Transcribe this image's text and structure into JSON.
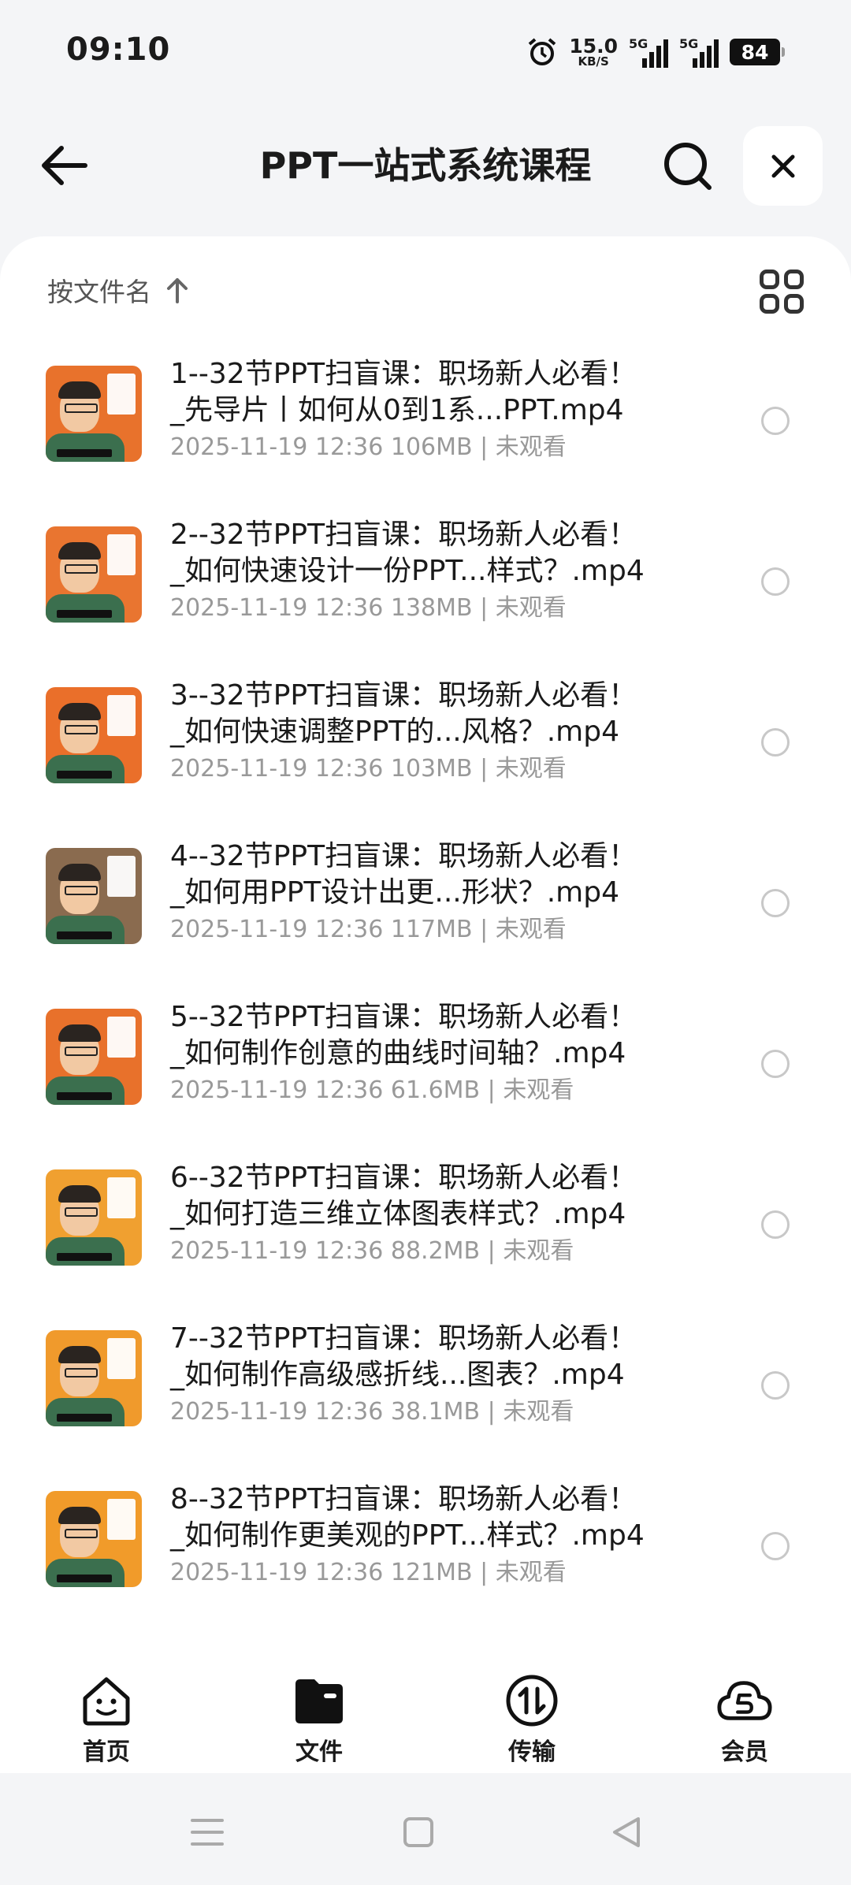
{
  "status": {
    "time": "09:10",
    "speed_value": "15.0",
    "speed_unit": "KB/S",
    "signal1": "5G",
    "signal2": "5G",
    "battery": "84"
  },
  "header": {
    "title": "PPT一站式系统课程"
  },
  "sort": {
    "label": "按文件名"
  },
  "files": [
    {
      "line1": "1--32节PPT扫盲课：职场新人必看！",
      "line2": "_先导片丨如何从0到1系...PPT.mp4",
      "meta": "2025-11-19 12:36  106MB | 未观看",
      "thumb_color": "#e8722c"
    },
    {
      "line1": "2--32节PPT扫盲课：职场新人必看！",
      "line2": "_如何快速设计一份PPT...样式？.mp4",
      "meta": "2025-11-19 12:36  138MB | 未观看",
      "thumb_color": "#e97530"
    },
    {
      "line1": "3--32节PPT扫盲课：职场新人必看！",
      "line2": "_如何快速调整PPT的...风格？.mp4",
      "meta": "2025-11-19 12:36  103MB | 未观看",
      "thumb_color": "#ea6f2a"
    },
    {
      "line1": "4--32节PPT扫盲课：职场新人必看！",
      "line2": "_如何用PPT设计出更...形状？.mp4",
      "meta": "2025-11-19 12:36  117MB | 未观看",
      "thumb_color": "#8a6b4f"
    },
    {
      "line1": "5--32节PPT扫盲课：职场新人必看！",
      "line2": "_如何制作创意的曲线时间轴？.mp4",
      "meta": "2025-11-19 12:36  61.6MB | 未观看",
      "thumb_color": "#e8712b"
    },
    {
      "line1": "6--32节PPT扫盲课：职场新人必看！",
      "line2": "_如何打造三维立体图表样式？.mp4",
      "meta": "2025-11-19 12:36  88.2MB | 未观看",
      "thumb_color": "#f0a030"
    },
    {
      "line1": "7--32节PPT扫盲课：职场新人必看！",
      "line2": "_如何制作高级感折线...图表？.mp4",
      "meta": "2025-11-19 12:36  38.1MB | 未观看",
      "thumb_color": "#f09a2c"
    },
    {
      "line1": "8--32节PPT扫盲课：职场新人必看！",
      "line2": "_如何制作更美观的PPT...样式？.mp4",
      "meta": "2025-11-19 12:36  121MB | 未观看",
      "thumb_color": "#f19b2a"
    }
  ],
  "tabs": [
    {
      "label": "首页",
      "icon": "home-face-icon"
    },
    {
      "label": "文件",
      "icon": "folder-icon"
    },
    {
      "label": "传输",
      "icon": "transfer-icon"
    },
    {
      "label": "会员",
      "icon": "vip-cloud-icon"
    }
  ],
  "colors": {
    "accent": "#1b1b1b",
    "meta_text": "#999999",
    "background": "#f4f5f7"
  }
}
